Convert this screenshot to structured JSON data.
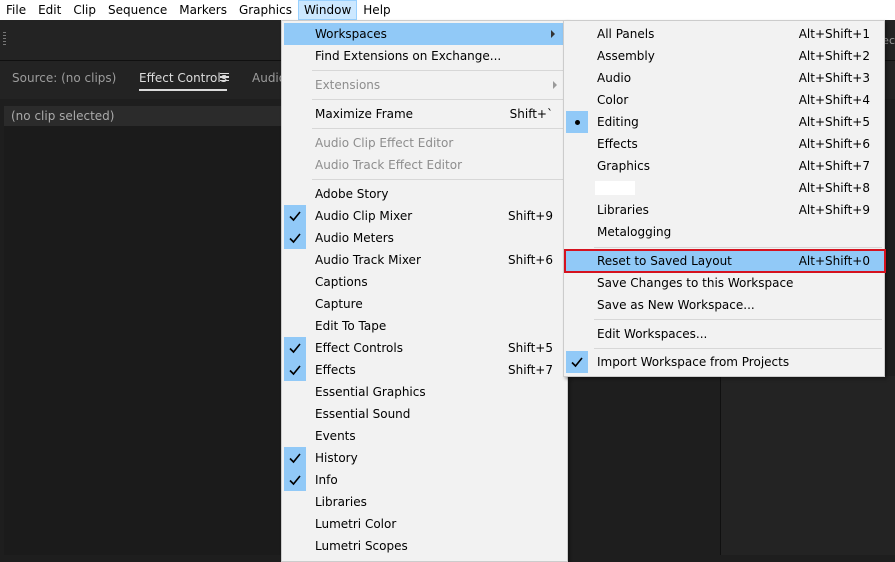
{
  "menubar": {
    "items": [
      "File",
      "Edit",
      "Clip",
      "Sequence",
      "Markers",
      "Graphics",
      "Window",
      "Help"
    ],
    "active": "Window"
  },
  "toolbar": {
    "edge_text": "ec"
  },
  "panel": {
    "tabs": [
      "Source: (no clips)",
      "Effect Controls",
      "Audio"
    ],
    "active_tab": "Effect Controls",
    "header": "(no clip selected)"
  },
  "window_menu": {
    "items": [
      {
        "label": "Workspaces",
        "submenu": true,
        "highlighted": true
      },
      {
        "label": "Find Extensions on Exchange..."
      },
      {
        "label": "Extensions",
        "submenu": true,
        "disabled": true
      },
      {
        "label": "Maximize Frame",
        "shortcut": "Shift+`"
      },
      {
        "label": "Audio Clip Effect Editor",
        "disabled": true
      },
      {
        "label": "Audio Track Effect Editor",
        "disabled": true
      },
      {
        "label": "Adobe Story"
      },
      {
        "label": "Audio Clip Mixer",
        "shortcut": "Shift+9",
        "checked": true
      },
      {
        "label": "Audio Meters",
        "checked": true
      },
      {
        "label": "Audio Track Mixer",
        "shortcut": "Shift+6"
      },
      {
        "label": "Captions"
      },
      {
        "label": "Capture"
      },
      {
        "label": "Edit To Tape"
      },
      {
        "label": "Effect Controls",
        "shortcut": "Shift+5",
        "checked": true
      },
      {
        "label": "Effects",
        "shortcut": "Shift+7",
        "checked": true
      },
      {
        "label": "Essential Graphics"
      },
      {
        "label": "Essential Sound"
      },
      {
        "label": "Events"
      },
      {
        "label": "History",
        "checked": true
      },
      {
        "label": "Info",
        "checked": true
      },
      {
        "label": "Libraries"
      },
      {
        "label": "Lumetri Color"
      },
      {
        "label": "Lumetri Scopes"
      }
    ]
  },
  "workspaces_menu": {
    "items": [
      {
        "label": "All Panels",
        "shortcut": "Alt+Shift+1"
      },
      {
        "label": "Assembly",
        "shortcut": "Alt+Shift+2"
      },
      {
        "label": "Audio",
        "shortcut": "Alt+Shift+3"
      },
      {
        "label": "Color",
        "shortcut": "Alt+Shift+4"
      },
      {
        "label": "Editing",
        "shortcut": "Alt+Shift+5",
        "selected": true
      },
      {
        "label": "Effects",
        "shortcut": "Alt+Shift+6"
      },
      {
        "label": "Graphics",
        "shortcut": "Alt+Shift+7"
      },
      {
        "label": "",
        "shortcut": "Alt+Shift+8",
        "redacted": true
      },
      {
        "label": "Libraries",
        "shortcut": "Alt+Shift+9"
      },
      {
        "label": "Metalogging"
      },
      {
        "label": "Reset to Saved Layout",
        "shortcut": "Alt+Shift+0",
        "highlighted": true
      },
      {
        "label": "Save Changes to this Workspace"
      },
      {
        "label": "Save as New Workspace..."
      },
      {
        "label": "Edit Workspaces..."
      },
      {
        "label": "Import Workspace from Projects",
        "checked": true
      }
    ]
  },
  "colors": {
    "highlight": "#91c9f7",
    "menu_bg": "#f2f2f2",
    "annotation_red": "#d5121f"
  }
}
